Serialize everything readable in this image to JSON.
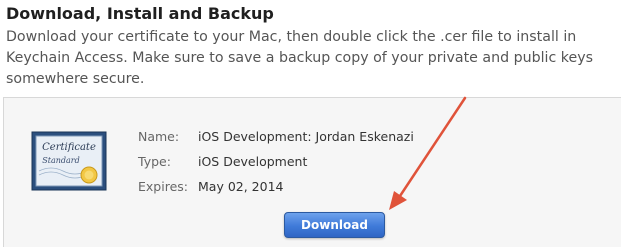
{
  "section": {
    "heading": "Download, Install and Backup",
    "description": "Download your certificate to your Mac, then double click the .cer file to install in Keychain Access. Make sure to save a backup copy of your private and public keys somewhere secure."
  },
  "certificate": {
    "icon": "certificate-icon",
    "icon_title": "Certificate",
    "icon_subtitle": "Standard",
    "fields": [
      {
        "label": "Name:",
        "value": "iOS Development: Jordan Eskenazi"
      },
      {
        "label": "Type:",
        "value": "iOS Development"
      },
      {
        "label": "Expires:",
        "value": "May 02, 2014"
      }
    ]
  },
  "actions": {
    "download_label": "Download"
  },
  "colors": {
    "button": "#3f7ad9",
    "arrow": "#e0533a",
    "panel": "#f6f6f6"
  }
}
